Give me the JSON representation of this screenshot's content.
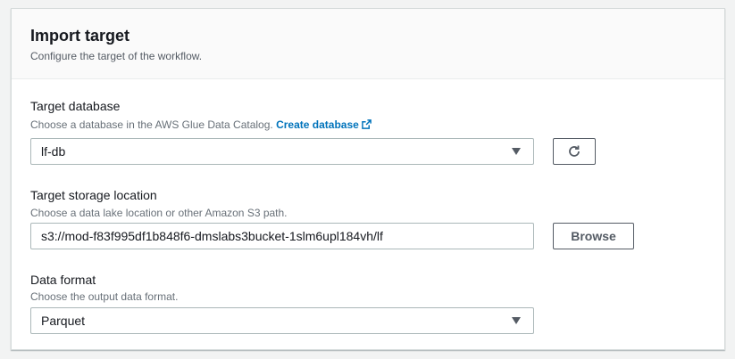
{
  "header": {
    "title": "Import target",
    "description": "Configure the target of the workflow."
  },
  "target_database": {
    "label": "Target database",
    "description": "Choose a database in the AWS Glue Data Catalog.",
    "create_link": "Create database",
    "selected": "lf-db",
    "refresh_icon": "refresh-icon",
    "external_icon": "external-link-icon"
  },
  "target_storage": {
    "label": "Target storage location",
    "description": "Choose a data lake location or other Amazon S3 path.",
    "value": "s3://mod-f83f995df1b848f6-dmslabs3bucket-1slm6upl184vh/lf",
    "browse_label": "Browse"
  },
  "data_format": {
    "label": "Data format",
    "description": "Choose the output data format.",
    "selected": "Parquet"
  },
  "colors": {
    "link": "#0073bb",
    "border": "#aab7b8",
    "text": "#16191f"
  }
}
